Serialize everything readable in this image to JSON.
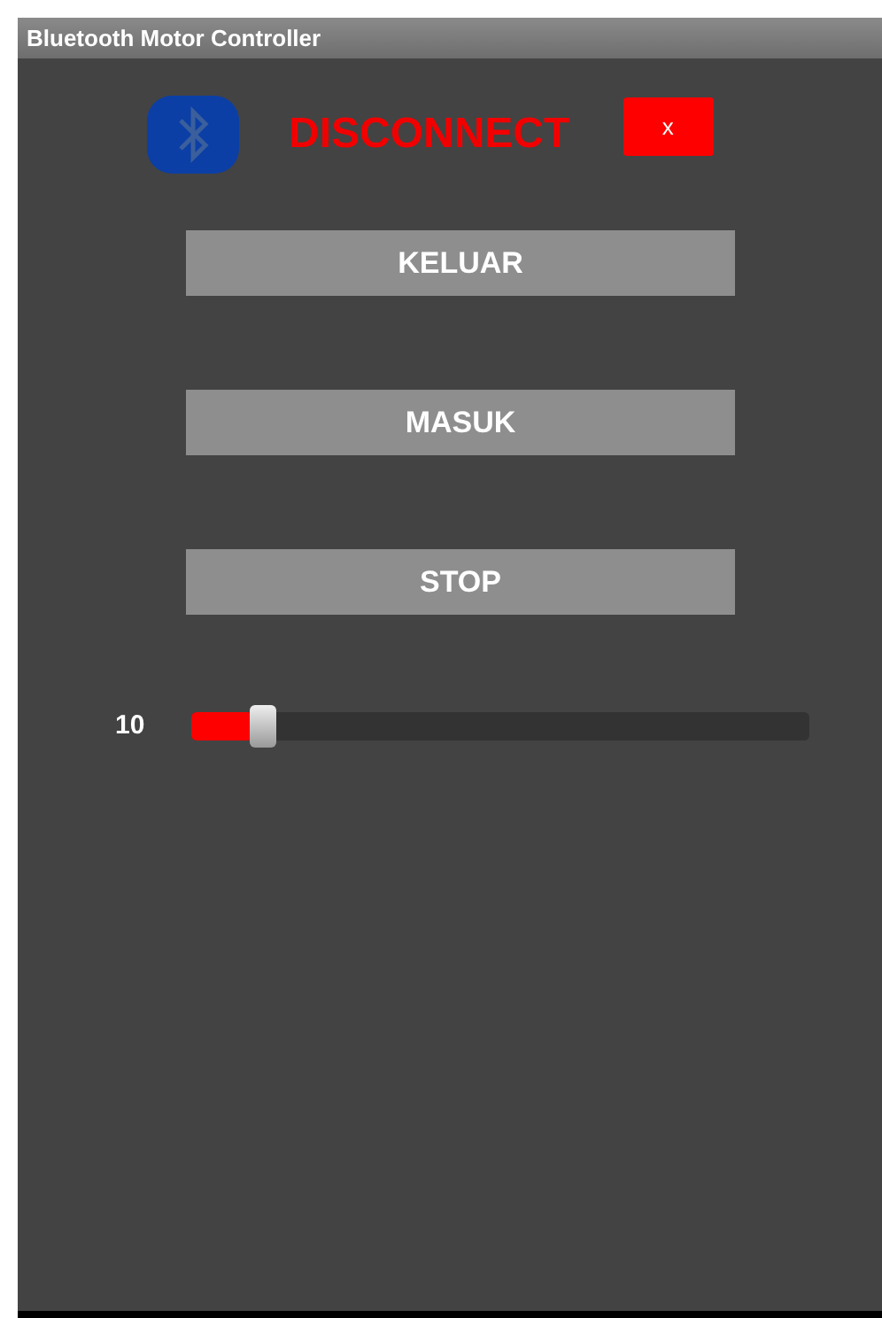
{
  "window": {
    "title": "Bluetooth Motor Controller"
  },
  "header": {
    "status": "DISCONNECT",
    "close_label": "x"
  },
  "buttons": [
    "KELUAR",
    "MASUK",
    "STOP"
  ],
  "slider": {
    "reading": "10",
    "level": 0.1
  }
}
